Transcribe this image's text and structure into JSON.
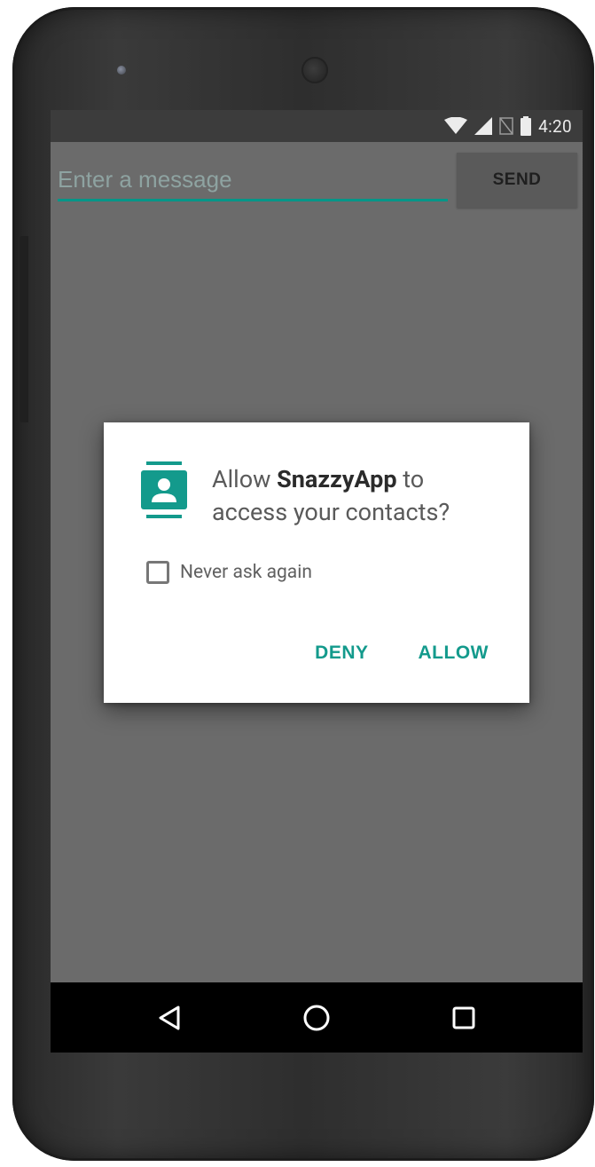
{
  "status_bar": {
    "time": "4:20",
    "icons": [
      "wifi-icon",
      "cell-signal-icon",
      "no-sim-icon",
      "battery-icon"
    ]
  },
  "compose": {
    "placeholder": "Enter a message",
    "send_label": "SEND"
  },
  "permission_dialog": {
    "title_prefix": "Allow ",
    "app_name": "SnazzyApp",
    "title_mid": " to",
    "title_suffix": "access your contacts?",
    "icon": "contacts-icon",
    "checkbox_label": "Never ask again",
    "deny_label": "DENY",
    "allow_label": "ALLOW"
  },
  "navigation": [
    "back-icon",
    "home-icon",
    "recents-icon"
  ],
  "colors": {
    "accent": "#009688",
    "screen_dim": "#6b6b6b",
    "status_bar": "#3c3c3c"
  }
}
